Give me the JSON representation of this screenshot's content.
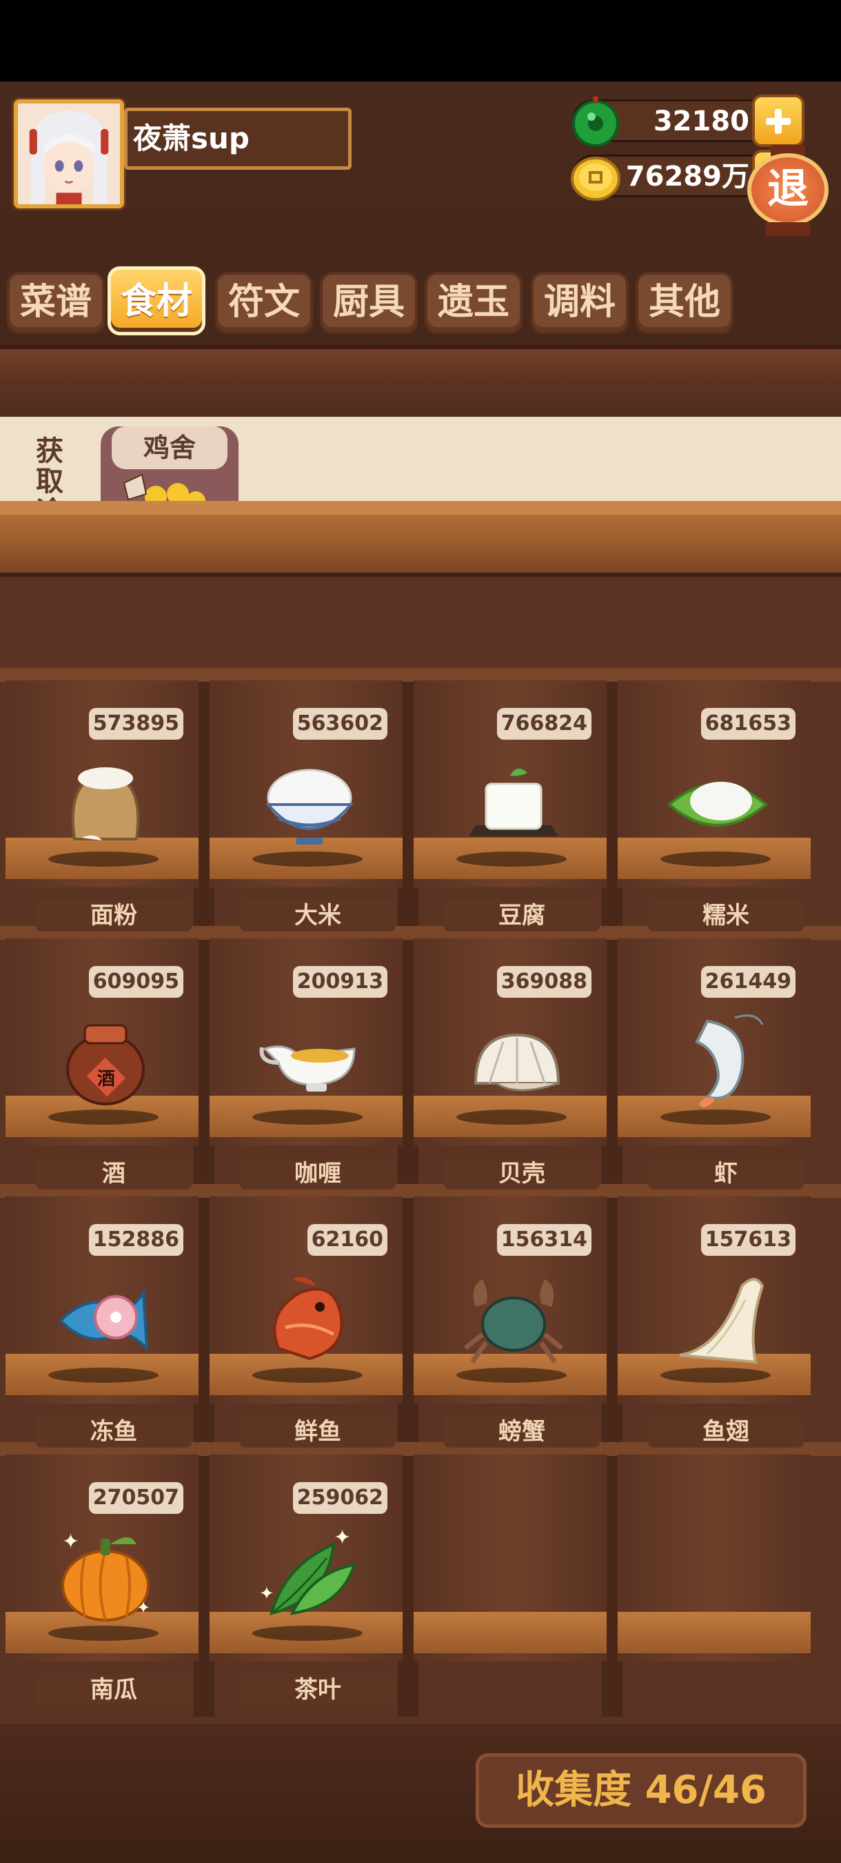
{
  "player": {
    "name": "夜萧sup"
  },
  "currency": {
    "jade": {
      "value": "32180",
      "icon": "green-jade-icon"
    },
    "gold": {
      "value": "76289万",
      "icon": "gold-coin-icon"
    }
  },
  "exit_label": "退",
  "tabs": [
    {
      "label": "菜谱",
      "active": false
    },
    {
      "label": "食材",
      "active": true
    },
    {
      "label": "符文",
      "active": false
    },
    {
      "label": "厨具",
      "active": false
    },
    {
      "label": "遗玉",
      "active": false
    },
    {
      "label": "调料",
      "active": false
    },
    {
      "label": "其他",
      "active": false
    }
  ],
  "source": {
    "label": "获取途径",
    "card": {
      "tag": "鸡舍",
      "sign": "鸡舍"
    }
  },
  "items": [
    {
      "name": "面粉",
      "count": "573895",
      "icon": "flour-sack-icon"
    },
    {
      "name": "大米",
      "count": "563602",
      "icon": "rice-bowl-icon"
    },
    {
      "name": "豆腐",
      "count": "766824",
      "icon": "tofu-icon"
    },
    {
      "name": "糯米",
      "count": "681653",
      "icon": "sticky-rice-leaf-icon"
    },
    {
      "name": "酒",
      "count": "609095",
      "icon": "wine-jar-icon"
    },
    {
      "name": "咖喱",
      "count": "200913",
      "icon": "curry-gravy-boat-icon"
    },
    {
      "name": "贝壳",
      "count": "369088",
      "icon": "clam-shell-icon"
    },
    {
      "name": "虾",
      "count": "261449",
      "icon": "shrimp-icon"
    },
    {
      "name": "冻鱼",
      "count": "152886",
      "icon": "frozen-fish-icon"
    },
    {
      "name": "鲜鱼",
      "count": "62160",
      "icon": "fresh-fish-icon"
    },
    {
      "name": "螃蟹",
      "count": "156314",
      "icon": "crab-icon"
    },
    {
      "name": "鱼翅",
      "count": "157613",
      "icon": "shark-fin-icon"
    },
    {
      "name": "南瓜",
      "count": "270507",
      "icon": "pumpkin-icon"
    },
    {
      "name": "茶叶",
      "count": "259062",
      "icon": "tea-leaves-icon"
    }
  ],
  "collection": {
    "label": "收集度 46/46"
  }
}
